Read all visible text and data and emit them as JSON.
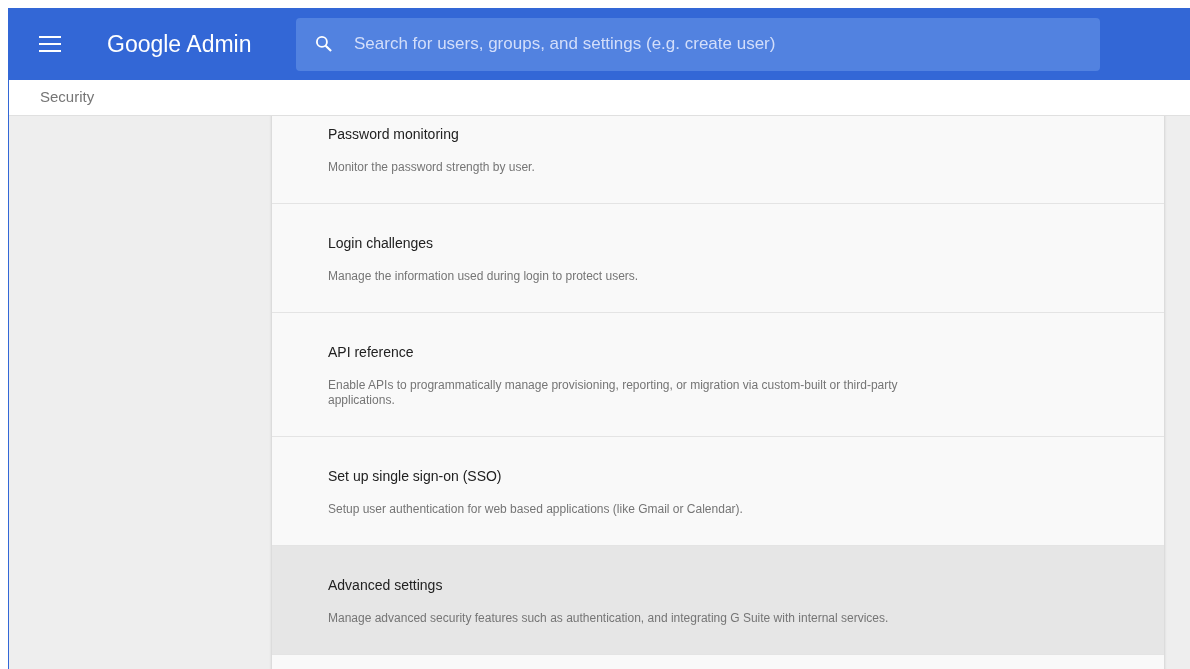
{
  "header": {
    "logo": "Google Admin",
    "search": {
      "placeholder": "Search for users, groups, and settings (e.g. create user)"
    }
  },
  "breadcrumb": "Security",
  "settings": [
    {
      "title": "Password monitoring",
      "description": "Monitor the password strength by user.",
      "selected": false
    },
    {
      "title": "Login challenges",
      "description": "Manage the information used during login to protect users.",
      "selected": false
    },
    {
      "title": "API reference",
      "description": "Enable APIs to programmatically manage provisioning, reporting, or migration via custom-built or third-party applications.",
      "selected": false
    },
    {
      "title": "Set up single sign-on (SSO)",
      "description": "Setup user authentication for web based applications (like Gmail or Calendar).",
      "selected": false
    },
    {
      "title": "Advanced settings",
      "description": "Manage advanced security features such as authentication, and integrating G Suite with internal services.",
      "selected": true
    }
  ]
}
